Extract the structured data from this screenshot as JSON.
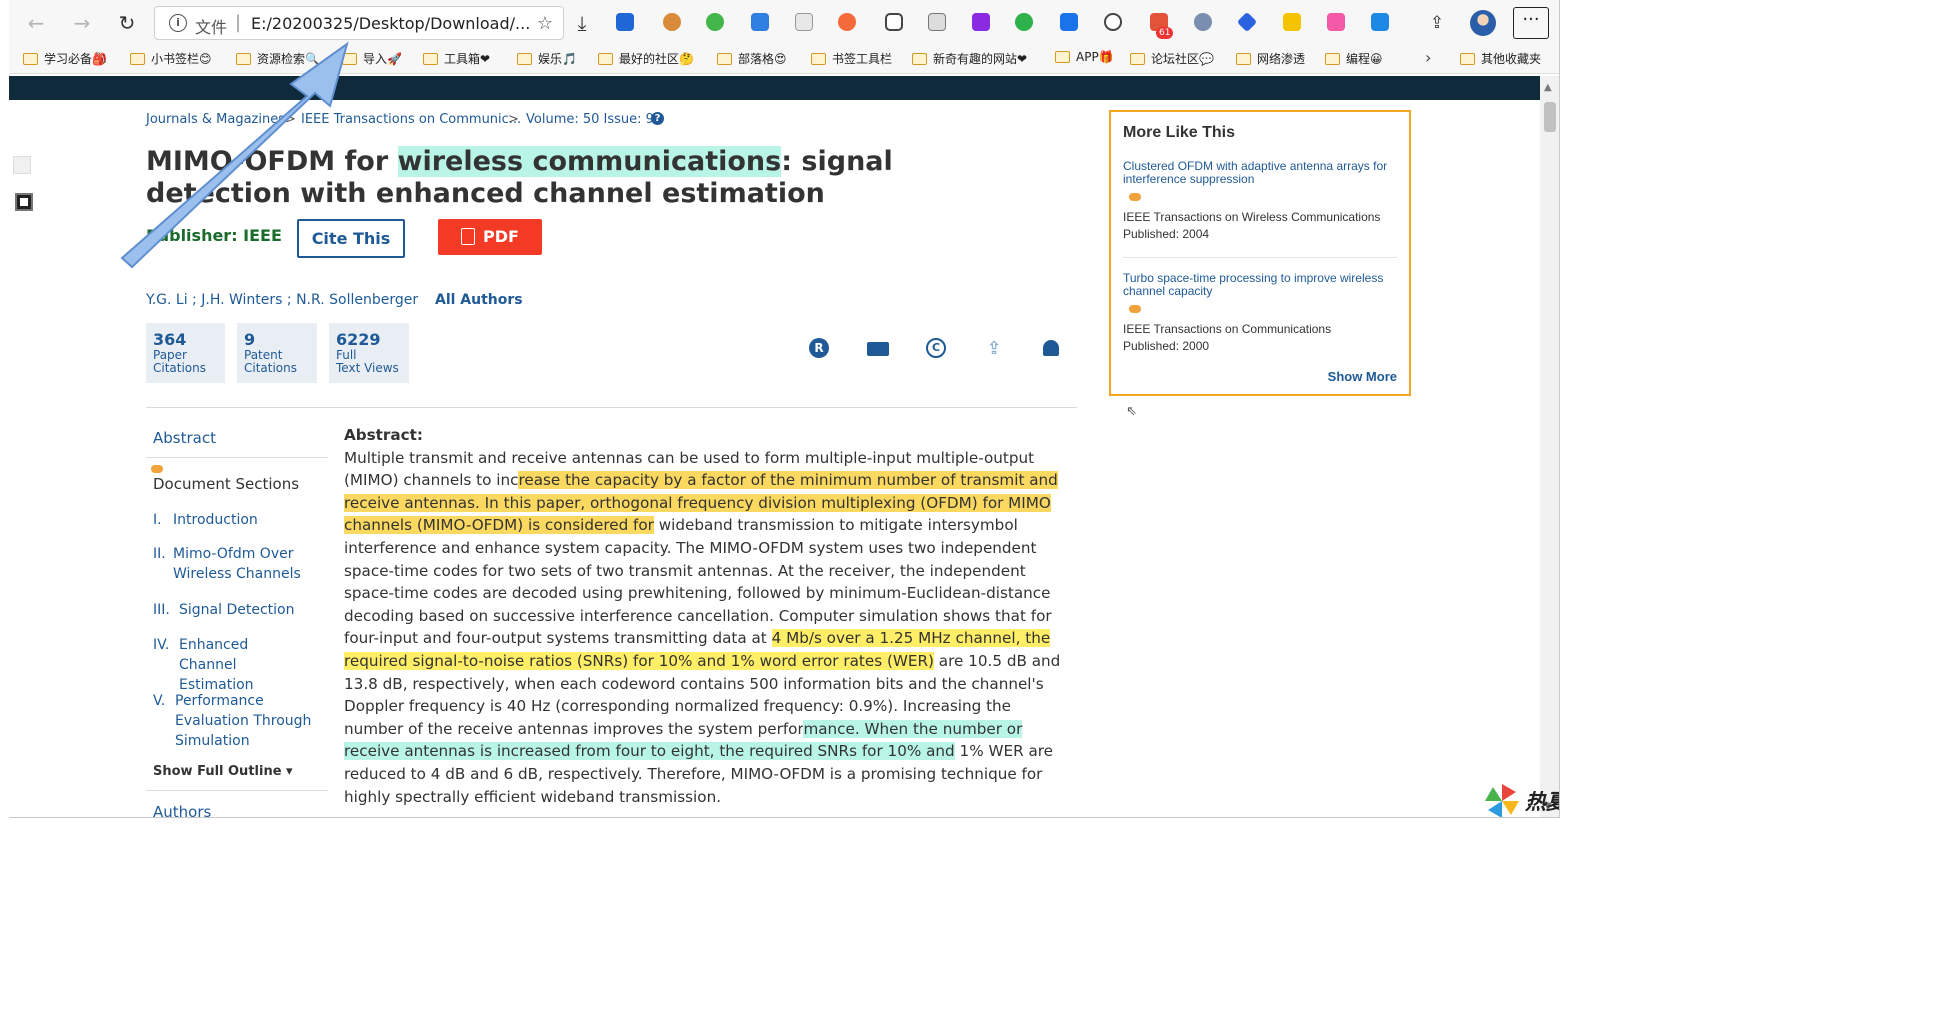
{
  "browser": {
    "address_label": "文件",
    "url": "E:/20200325/Desktop/Download/...",
    "tab_badge": "61"
  },
  "bookmarks": [
    {
      "label": "学习必备🎒"
    },
    {
      "label": "小书签栏😊"
    },
    {
      "label": "资源检索🔍"
    },
    {
      "label": "导入🚀"
    },
    {
      "label": "工具箱❤"
    },
    {
      "label": "娱乐🎵"
    },
    {
      "label": "最好的社区🤔"
    },
    {
      "label": "部落格😍"
    },
    {
      "label": "书签工具栏"
    },
    {
      "label": "新奇有趣的网站❤"
    },
    {
      "label": "APP🎁"
    },
    {
      "label": "论坛社区💬"
    },
    {
      "label": "网络渗透"
    },
    {
      "label": "编程😀"
    },
    {
      "label": "其他收藏夹"
    }
  ],
  "breadcrumb": {
    "item1": "Journals & Magazines",
    "item2": "IEEE Transactions on Communic...",
    "item3": "Volume: 50 Issue: 9",
    "sep": ">"
  },
  "article": {
    "title_part1": "MIMO-OFDM for ",
    "title_highlight": "wireless communications",
    "title_part2": ": signal detection with enhanced channel estimation",
    "publisher": "Publisher:  IEEE",
    "cite_label": "Cite This",
    "pdf_label": "PDF",
    "authors": [
      "Y.G. Li",
      "J.H. Winters",
      "N.R. Sollenberger"
    ],
    "all_authors": "All Authors"
  },
  "metrics": [
    {
      "value": "364",
      "line1": "Paper",
      "line2": "Citations"
    },
    {
      "value": "9",
      "line1": "Patent",
      "line2": "Citations"
    },
    {
      "value": "6229",
      "line1": "Full",
      "line2": "Text Views"
    }
  ],
  "more_like_this": {
    "heading": "More Like This",
    "items": [
      {
        "title": "Clustered OFDM with adaptive antenna arrays for interference suppression",
        "journal": "IEEE Transactions on Wireless Communications",
        "published": "Published: 2004"
      },
      {
        "title": "Turbo space-time processing to improve wireless channel capacity",
        "journal": "IEEE Transactions on Communications",
        "published": "Published: 2000"
      }
    ],
    "show_more": "Show More"
  },
  "sidenav": {
    "abstract": "Abstract",
    "doc_sections": "Document Sections",
    "sections": [
      {
        "num": "I.",
        "title": "Introduction"
      },
      {
        "num": "II.",
        "title": "Mimo-Ofdm Over Wireless Channels"
      },
      {
        "num": "III.",
        "title": "Signal Detection"
      },
      {
        "num": "IV.",
        "title": "Enhanced Channel Estimation"
      },
      {
        "num": "V.",
        "title": "Performance Evaluation Through Simulation"
      }
    ],
    "full_outline": "Show Full Outline ▾",
    "authors": "Authors"
  },
  "abstract": {
    "heading": "Abstract:",
    "s1": "Multiple transmit and receive antennas can be used to form multiple-input multiple-output (MIMO) channels to inc",
    "h1": "rease the capacity by a factor of the minimum number of transmit and receive antennas. In this paper, orthogonal frequency division multiplexing (OFDM) for MIMO channels (MIMO-OFDM) is considered for",
    "s2": " wideband transmission to mitigate intersymbol interference and enhance system capacity. The MIMO-OFDM system uses two independent space-time codes for two sets of two transmit antennas. At the receiver, the independent space-time codes are decoded using prewhitening, followed by minimum-Euclidean-distance decoding based on successive interference cancellation. Computer simulation shows that for four-input and four-output systems transmitting data at ",
    "h2": "4 Mb/s over a 1.25 MHz channel, the required signal-to-noise ratios (SNRs) for 10% and 1% word error rates (WER)",
    "s3": " are 10.5 dB and 13.8 dB, respectively, when each codeword contains 500 information bits and the channel's Doppler frequency is 40 Hz (corresponding normalized frequency: 0.9%). Increasing the number of the receive antennas improves the system perfor",
    "h3": "mance. When the number or receive antennas is increased from four to eight, the required SNRs for 10% and",
    "s4": " 1% WER are reduced to 4 dB and 6 dB, respectively. Therefore, MIMO-OFDM is a promising technique for highly spectrally efficient wideband transmission."
  },
  "watermark": "热夏",
  "colors": {
    "link": "#1f5a96",
    "pdf_button": "#f23a25",
    "highlight_yellow": "#fbd85f",
    "highlight_green": "#b9f5e6",
    "panel_border": "#f5a623",
    "dark_bar": "#0f2a3b"
  }
}
